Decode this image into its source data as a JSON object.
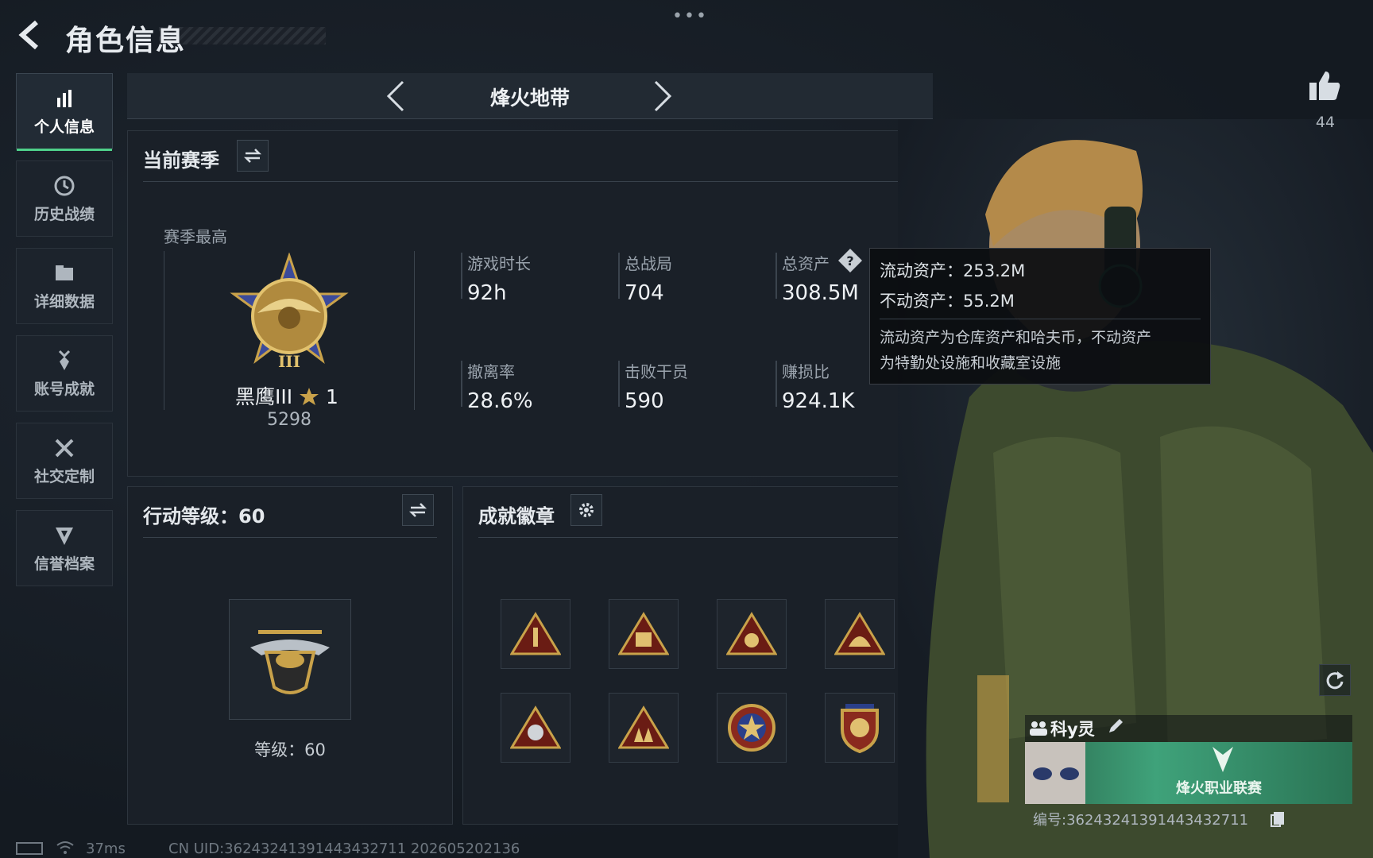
{
  "header": {
    "title": "角色信息",
    "more": "•••"
  },
  "sidebar": {
    "items": [
      {
        "label": "个人信息",
        "icon": "bar-chart-icon",
        "active": true
      },
      {
        "label": "历史战绩",
        "icon": "clock-icon",
        "active": false
      },
      {
        "label": "详细数据",
        "icon": "folder-icon",
        "active": false
      },
      {
        "label": "账号成就",
        "icon": "medal-icon",
        "active": false
      },
      {
        "label": "社交定制",
        "icon": "tools-icon",
        "active": false
      },
      {
        "label": "信誉档案",
        "icon": "shield-icon",
        "active": false
      }
    ]
  },
  "mode": {
    "title": "烽火地带"
  },
  "season": {
    "title": "当前赛季",
    "best_label": "赛季最高",
    "rank_name": "黑鹰III",
    "rank_stars": "1",
    "rank_points": "5298",
    "stats": [
      {
        "label": "游戏时长",
        "value": "92h"
      },
      {
        "label": "总战局",
        "value": "704"
      },
      {
        "label": "总资产",
        "value": "308.5M"
      },
      {
        "label": "撤离率",
        "value": "28.6%"
      },
      {
        "label": "击败干员",
        "value": "590"
      },
      {
        "label": "赚损比",
        "value": "924.1K"
      }
    ]
  },
  "tooltip": {
    "liquid": "流动资产：253.2M",
    "fixed": "不动资产：55.2M",
    "desc1": "流动资产为仓库资产和哈夫币，不动资产",
    "desc2": "为特勤处设施和收藏室设施"
  },
  "action_level": {
    "title": "行动等级：60",
    "level_text": "等级：60"
  },
  "achievements": {
    "title": "成就徽章"
  },
  "player": {
    "likes": "44",
    "name": "科y灵",
    "banner_text": "烽火职业联赛",
    "id_text": "编号:36243241391443432711"
  },
  "status": {
    "ping": "37ms",
    "uid": "CN UID:36243241391443432711 202605202136"
  },
  "colors": {
    "accent": "#4fd08a",
    "gold": "#c9a24a",
    "panel": "#1a2028"
  }
}
